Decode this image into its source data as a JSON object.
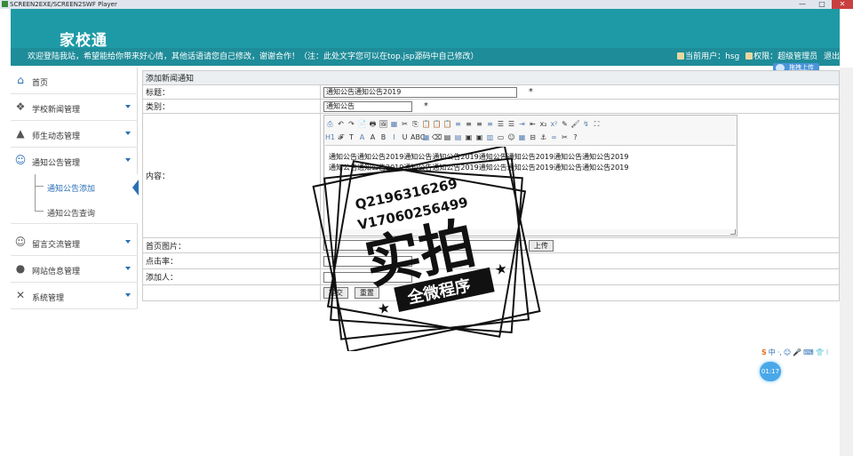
{
  "window": {
    "title": "SCREEN2EXE/SCREEN2SWF Player",
    "min": "—",
    "max": "□",
    "close": "✕"
  },
  "header": {
    "logo": "家校通"
  },
  "infobar": {
    "welcome": "欢迎登陆我站，希望能给你带来好心情，其他话语请您自己修改，谢谢合作！（注：此处文字您可以在top.jsp源码中自己修改）",
    "current_user_label": "当前用户：",
    "current_user": "hsg",
    "role_label": "权限：",
    "role": "超级管理员",
    "logout": "退出"
  },
  "upload_badge": "拖拽上传",
  "sidebar": {
    "items": [
      {
        "label": "首页",
        "icon": "home-icon"
      },
      {
        "label": "学校新闻管理",
        "icon": "puzzle-icon"
      },
      {
        "label": "师生动态管理",
        "icon": "graduation-icon"
      },
      {
        "label": "通知公告管理",
        "icon": "users-icon"
      },
      {
        "label": "留言交流管理",
        "icon": "users-icon"
      },
      {
        "label": "网站信息管理",
        "icon": "user-icon"
      },
      {
        "label": "系统管理",
        "icon": "tools-icon"
      }
    ],
    "subitems": [
      {
        "label": "通知公告添加",
        "active": true
      },
      {
        "label": "通知公告查询",
        "active": false
      }
    ]
  },
  "form": {
    "heading": "添加新闻通知",
    "title_label": "标题：",
    "title_value": "通知公告通知公告2019",
    "category_label": "类别：",
    "category_value": "通知公告",
    "required_mark": "*",
    "content_label": "内容：",
    "content_line1": "通知公告通知公告2019通知公告通知公告2019通知公告通知公告2019通知公告通知公告2019",
    "content_line2": "通知公告通知公告2019通知公告通知公告2019通知公告通知公告2019通知公告通知公告2019",
    "image_label": "首页图片：",
    "upload_btn": "上传",
    "clicks_label": "点击率：",
    "adder_label": "添加人：",
    "submit_btn": "提交",
    "reset_btn": "重置"
  },
  "toolbar": {
    "row1": [
      "⎙",
      "↶",
      "↷",
      "📄",
      "🖶",
      "🖼",
      "▦",
      "✂",
      "⎘",
      "📋",
      "📋",
      "📋",
      "≡",
      "≡",
      "≡",
      "≡",
      "☰",
      "☰",
      "⇥",
      "⇤",
      "x₂",
      "x²",
      "✎",
      "🖌",
      "↯",
      "⛶"
    ],
    "row2": [
      "H1",
      "𝓕",
      "T",
      "A",
      "A",
      "B",
      "I",
      "U",
      "ABC",
      "▦",
      "⌫",
      "▤",
      "▤",
      "▣",
      "▣",
      "▥",
      "▭",
      "☺",
      "▦",
      "⊟",
      "⚓",
      "∞",
      "✂",
      "?"
    ]
  },
  "ime": {
    "logo": "S",
    "items": [
      "中",
      "·,",
      "☺",
      "🎤",
      "⌨",
      "👕",
      "⁝"
    ]
  },
  "timer": "01:17",
  "watermark": {
    "line1": "Q2196316269",
    "line2": "V17060256499",
    "big": "实拍",
    "banner": "全微程序"
  },
  "colors": {
    "header": "#1e9aa6",
    "infobar": "#1e8c99",
    "accent": "#2a6fb4"
  }
}
